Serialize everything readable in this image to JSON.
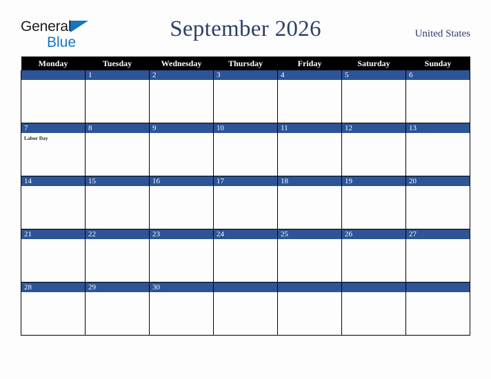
{
  "logo": {
    "line1": "General",
    "line2": "Blue",
    "triangle_color": "#1574bf",
    "text_color": "#1b1b1b"
  },
  "header": {
    "title": "September 2026",
    "country": "United States",
    "title_color": "#2b3f66"
  },
  "theme": {
    "day_header_bg": "#2d5496",
    "weekday_header_bg": "#000000",
    "weekday_header_text": "#ffffff",
    "page_bg": "#fdfdfd",
    "grid_line": "#000000"
  },
  "weekday_headers": [
    "Monday",
    "Tuesday",
    "Wednesday",
    "Thursday",
    "Friday",
    "Saturday",
    "Sunday"
  ],
  "weeks": [
    [
      {
        "day": "",
        "events": []
      },
      {
        "day": "1",
        "events": []
      },
      {
        "day": "2",
        "events": []
      },
      {
        "day": "3",
        "events": []
      },
      {
        "day": "4",
        "events": []
      },
      {
        "day": "5",
        "events": []
      },
      {
        "day": "6",
        "events": []
      }
    ],
    [
      {
        "day": "7",
        "events": [
          "Labor Day"
        ]
      },
      {
        "day": "8",
        "events": []
      },
      {
        "day": "9",
        "events": []
      },
      {
        "day": "10",
        "events": []
      },
      {
        "day": "11",
        "events": []
      },
      {
        "day": "12",
        "events": []
      },
      {
        "day": "13",
        "events": []
      }
    ],
    [
      {
        "day": "14",
        "events": []
      },
      {
        "day": "15",
        "events": []
      },
      {
        "day": "16",
        "events": []
      },
      {
        "day": "17",
        "events": []
      },
      {
        "day": "18",
        "events": []
      },
      {
        "day": "19",
        "events": []
      },
      {
        "day": "20",
        "events": []
      }
    ],
    [
      {
        "day": "21",
        "events": []
      },
      {
        "day": "22",
        "events": []
      },
      {
        "day": "23",
        "events": []
      },
      {
        "day": "24",
        "events": []
      },
      {
        "day": "25",
        "events": []
      },
      {
        "day": "26",
        "events": []
      },
      {
        "day": "27",
        "events": []
      }
    ],
    [
      {
        "day": "28",
        "events": []
      },
      {
        "day": "29",
        "events": []
      },
      {
        "day": "30",
        "events": []
      },
      {
        "day": "",
        "events": []
      },
      {
        "day": "",
        "events": []
      },
      {
        "day": "",
        "events": []
      },
      {
        "day": "",
        "events": []
      }
    ]
  ]
}
